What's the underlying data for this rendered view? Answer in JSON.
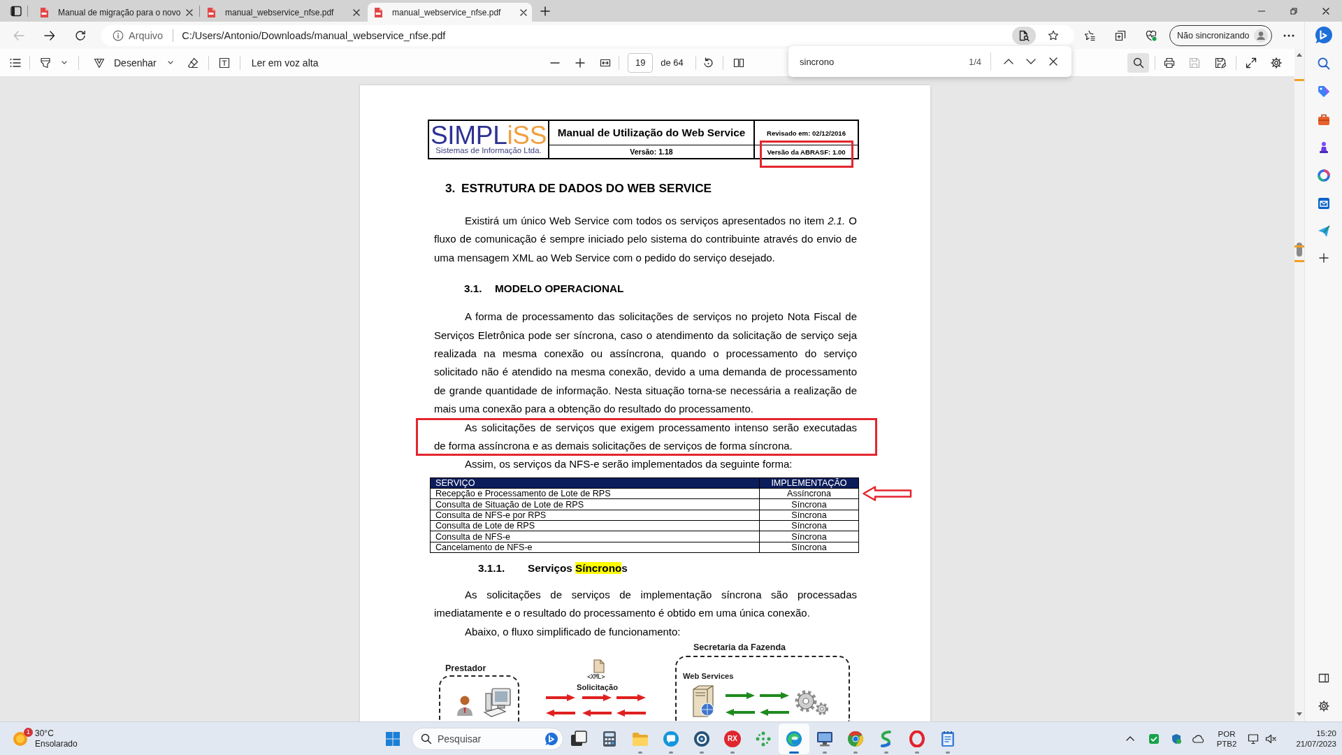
{
  "browser": {
    "tabs": [
      {
        "title": "Manual de migração para o novo",
        "selected": false
      },
      {
        "title": "manual_webservice_nfse.pdf",
        "selected": false
      },
      {
        "title": "manual_webservice_nfse.pdf",
        "selected": true
      }
    ],
    "address": {
      "scheme": "Arquivo",
      "url": "C:/Users/Antonio/Downloads/manual_webservice_nfse.pdf"
    },
    "profile": {
      "label": "Não sincronizando"
    }
  },
  "pdf_toolbar": {
    "draw_label": "Desenhar",
    "read_aloud_label": "Ler em voz alta",
    "page_number": "19",
    "page_count": "de 64"
  },
  "find_bar": {
    "query": "sincrono",
    "matches": "1/4"
  },
  "document": {
    "header": {
      "wordmark": [
        {
          "text": "SIMPL",
          "accent": false
        },
        {
          "text": "iSS",
          "accent": true
        }
      ],
      "tagline": "Sistemas de Informação Ltda.",
      "title": "Manual de Utilização do Web Service",
      "revised": "Revisado em: 02/12/2016",
      "version": "Versão: 1.18",
      "abrasf": {
        "text": "Versão da ABRASF: 1.00",
        "boxed": true
      }
    },
    "content": [
      {
        "kind": "heading",
        "number": "3.",
        "title": [
          {
            "text": "ESTRUTURA DE DADOS DO WEB SERVICE",
            "highlighted": false
          }
        ]
      },
      {
        "kind": "paragraph",
        "text": "Existirá um único Web Service com todos os serviços apresentados no item *2.1.* O fluxo de comunicação é sempre iniciado pelo sistema do contribuinte através do envio de uma mensagem XML ao Web Service com o pedido do serviço desejado.",
        "boxed": false
      },
      {
        "kind": "subheading",
        "number": "3.1.",
        "title": [
          {
            "text": "MODELO OPERACIONAL",
            "highlighted": false
          }
        ]
      },
      {
        "kind": "paragraph",
        "text": "A forma de processamento das solicitações de serviços no projeto Nota Fiscal de Serviços Eletrônica pode ser síncrona, caso o atendimento da solicitação de serviço seja realizada na mesma conexão ou assíncrona, quando o processamento do serviço solicitado não é atendido na mesma conexão, devido a uma demanda de processamento de grande quantidade de informação. Nesta situação torna-se necessária a realização de mais uma conexão para a obtenção do resultado do processamento.",
        "boxed": false
      },
      {
        "kind": "paragraph",
        "text": "As solicitações de serviços que exigem processamento intenso serão executadas de forma assíncrona e as demais solicitações de serviços de forma síncrona.",
        "boxed": true
      },
      {
        "kind": "paragraph",
        "text": "Assim, os serviços da NFS-e serão implementados da seguinte forma:",
        "boxed": false
      },
      {
        "kind": "table",
        "columns": [
          "SERVIÇO",
          "IMPLEMENTAÇÃO"
        ],
        "rows": [
          {
            "cells": [
              "Recepção e Processamento de Lote de RPS",
              "Assíncrona"
            ],
            "arrow": true
          },
          {
            "cells": [
              "Consulta de Situação de Lote de RPS",
              "Síncrona"
            ],
            "arrow": false
          },
          {
            "cells": [
              "Consulta de NFS-e por RPS",
              "Síncrona"
            ],
            "arrow": false
          },
          {
            "cells": [
              "Consulta de Lote de RPS",
              "Síncrona"
            ],
            "arrow": false
          },
          {
            "cells": [
              "Consulta de NFS-e",
              "Síncrona"
            ],
            "arrow": false
          },
          {
            "cells": [
              "Cancelamento de NFS-e",
              "Síncrona"
            ],
            "arrow": false
          }
        ]
      },
      {
        "kind": "subsubheading",
        "number": "3.1.1.",
        "title": [
          {
            "text": "Serviços ",
            "highlighted": false
          },
          {
            "text": "Síncrono",
            "highlighted": true
          },
          {
            "text": "s",
            "highlighted": false
          }
        ]
      },
      {
        "kind": "paragraph",
        "text": "As solicitações de serviços de implementação síncrona são processadas imediatamente e o resultado do processamento é obtido em uma única conexão.",
        "boxed": false
      },
      {
        "kind": "paragraph",
        "text": "Abaixo, o fluxo simplificado de funcionamento:",
        "boxed": false
      },
      {
        "kind": "diagram",
        "authority": "Secretaria da Fazenda",
        "provider": "Prestador",
        "xml": "<XML>",
        "request": "Solicitação",
        "web_services": "Web Services"
      }
    ]
  },
  "taskbar": {
    "weather": {
      "alerts": "1",
      "temperature": "30°C",
      "condition": "Ensolarado"
    },
    "search": {
      "placeholder": "Pesquisar"
    },
    "apps": [
      {
        "kind": "taskview",
        "running": false,
        "active": false
      },
      {
        "kind": "calculator",
        "running": false,
        "active": false
      },
      {
        "kind": "explorer",
        "running": true,
        "active": false
      },
      {
        "kind": "skype",
        "running": true,
        "active": false
      },
      {
        "kind": "github",
        "running": true,
        "active": false
      },
      {
        "kind": "rx",
        "label": "RX",
        "running": true,
        "active": false
      },
      {
        "kind": "dots",
        "running": false,
        "active": false
      },
      {
        "kind": "edge",
        "running": true,
        "active": true
      },
      {
        "kind": "remote",
        "running": true,
        "active": false
      },
      {
        "kind": "chrome",
        "running": true,
        "active": false
      },
      {
        "kind": "sapp",
        "running": true,
        "active": false
      },
      {
        "kind": "opera",
        "running": true,
        "active": false
      },
      {
        "kind": "notepad",
        "running": true,
        "active": false
      }
    ],
    "tray": {
      "language": "POR",
      "keyboard": "PTB2",
      "time": "15:20",
      "date": "21/07/2023"
    }
  }
}
